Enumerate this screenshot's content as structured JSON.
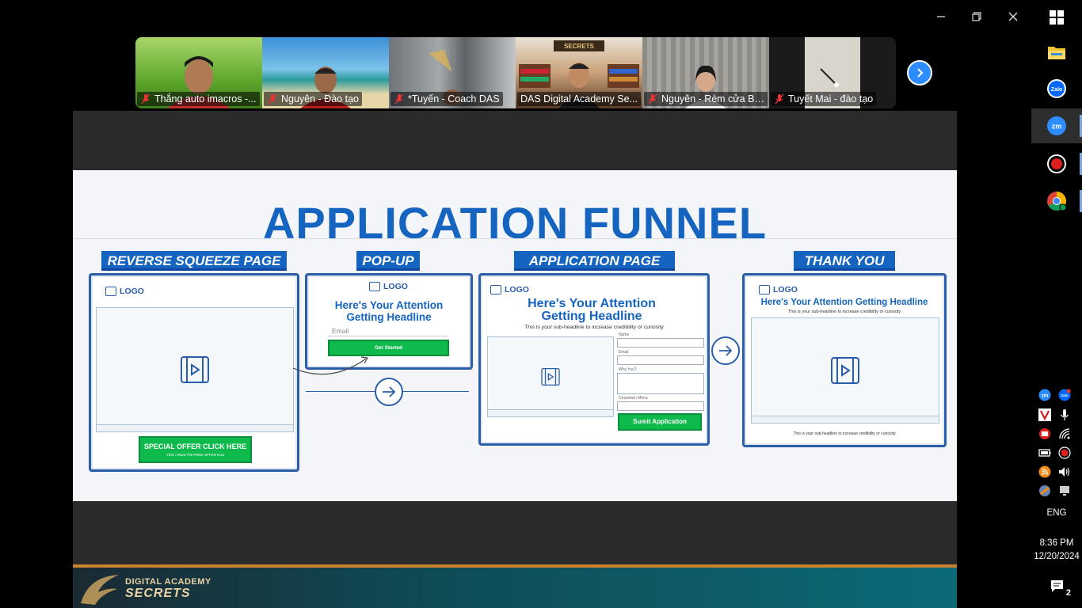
{
  "window": {
    "controls": [
      "minimize-icon",
      "restore-icon",
      "close-icon"
    ]
  },
  "participants": [
    {
      "name": "Thắng auto imacros -...",
      "muted": true,
      "bg": "#6fbf3a",
      "active": false
    },
    {
      "name": "Nguyên - Đào tạo",
      "muted": true,
      "bg": "#58a9d8",
      "active": false
    },
    {
      "name": "*Tuyến - Coach DAS",
      "muted": true,
      "bg": "#8a8f93",
      "active": false
    },
    {
      "name": "DAS Digital Academy Se...",
      "muted": false,
      "bg": "#7a5a3e",
      "active": true
    },
    {
      "name": "Nguyên - Rèm cửa Bli...",
      "muted": true,
      "bg": "#8c8c8a",
      "active": false
    },
    {
      "name": "Tuyết Mai - đào tạo",
      "muted": true,
      "bg": "#2a2a2a",
      "active": false
    }
  ],
  "strip": {
    "next_icon": "chevron-right-icon"
  },
  "slide": {
    "title": "APPLICATION FUNNEL",
    "steps": [
      {
        "label": "REVERSE SQUEEZE PAGE"
      },
      {
        "label": "POP-UP"
      },
      {
        "label": "APPLICATION PAGE"
      },
      {
        "label": "THANK YOU"
      }
    ],
    "logo_text": "LOGO",
    "squeeze": {
      "button": "SPECIAL OFFER CLICK HERE",
      "button_sub": "YES! I Want The FREE OFFER Now"
    },
    "popup": {
      "headline": "Here's Your Attention Getting Headline",
      "email_placeholder": "Email",
      "button": "Get Started"
    },
    "application": {
      "headline": "Here's Your Attention Getting Headline",
      "sub": "This is your sub-headline to increase credibility or curiosity",
      "fields": [
        "Name",
        "Email",
        "Why You?",
        "Dropdown Menu"
      ],
      "button": "Sumit Application"
    },
    "thankyou": {
      "headline": "Here's Your Attention Getting Headline",
      "sub": "This is your sub-headline to increase credibility or curiosity",
      "footer": "This is your sub-headline to increase credibility or curiosity"
    }
  },
  "brand": {
    "line1": "DIGITAL ACADEMY",
    "line2": "SECRETS"
  },
  "taskbar": {
    "apps": [
      "file-explorer-icon",
      "zalo-icon",
      "zoom-icon",
      "record-icon",
      "chrome-icon"
    ],
    "language": "ENG",
    "time": "8:36 PM",
    "date": "12/20/2024",
    "notification_count": "2"
  }
}
